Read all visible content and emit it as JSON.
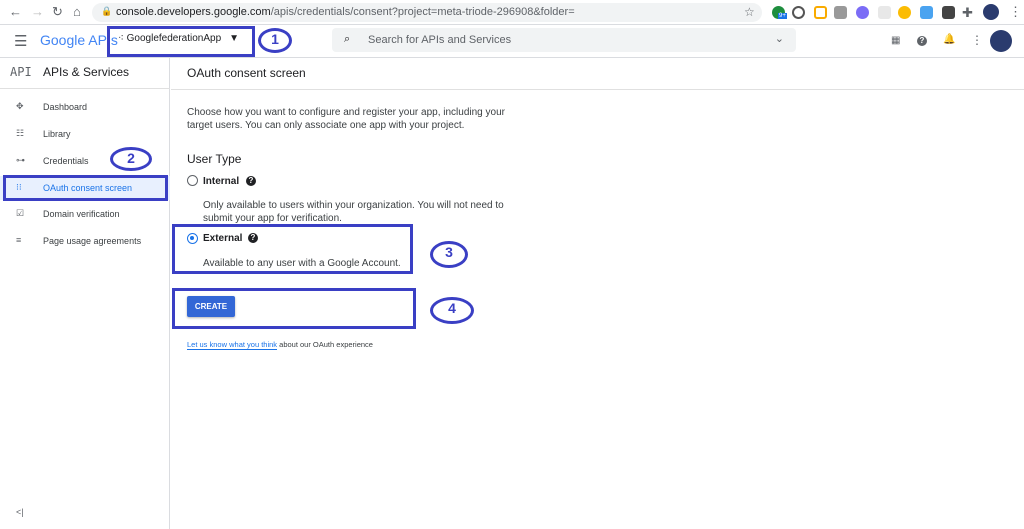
{
  "browser": {
    "url_host": "console.developers.google.com",
    "url_path": "/apis/credentials/consent?project=meta-triode-296908&folder=",
    "ext_badge": "9+"
  },
  "header": {
    "logo": "Google APIs",
    "project": "GooglefederationApp",
    "search_placeholder": "Search for APIs and Services"
  },
  "sidebar": {
    "badge": "API",
    "title": "APIs & Services",
    "collapse": "<|",
    "items": [
      {
        "label": "Dashboard",
        "icon": "✥"
      },
      {
        "label": "Library",
        "icon": "☷"
      },
      {
        "label": "Credentials",
        "icon": "⊶"
      },
      {
        "label": "OAuth consent screen",
        "icon": "⁝⁝"
      },
      {
        "label": "Domain verification",
        "icon": "☑"
      },
      {
        "label": "Page usage agreements",
        "icon": "≡"
      }
    ]
  },
  "main": {
    "title": "OAuth consent screen",
    "intro_line1": "Choose how you want to configure and register your app, including your",
    "intro_line2": "target users. You can only associate one app with your project.",
    "user_type": "User Type",
    "internal": {
      "label": "Internal",
      "desc1": "Only available to users within your organization. You will not need to",
      "desc2": "submit your app for verification."
    },
    "external": {
      "label": "External",
      "desc": "Available to any user with a Google Account."
    },
    "create": "CREATE",
    "feedback_link": "Let us know what you think",
    "feedback_rest": " about our OAuth experience"
  },
  "annotations": [
    "1",
    "2",
    "3",
    "4"
  ],
  "colors": {
    "accent": "#1a73e8",
    "annotation": "#3a3fc4",
    "button": "#3367d6"
  }
}
